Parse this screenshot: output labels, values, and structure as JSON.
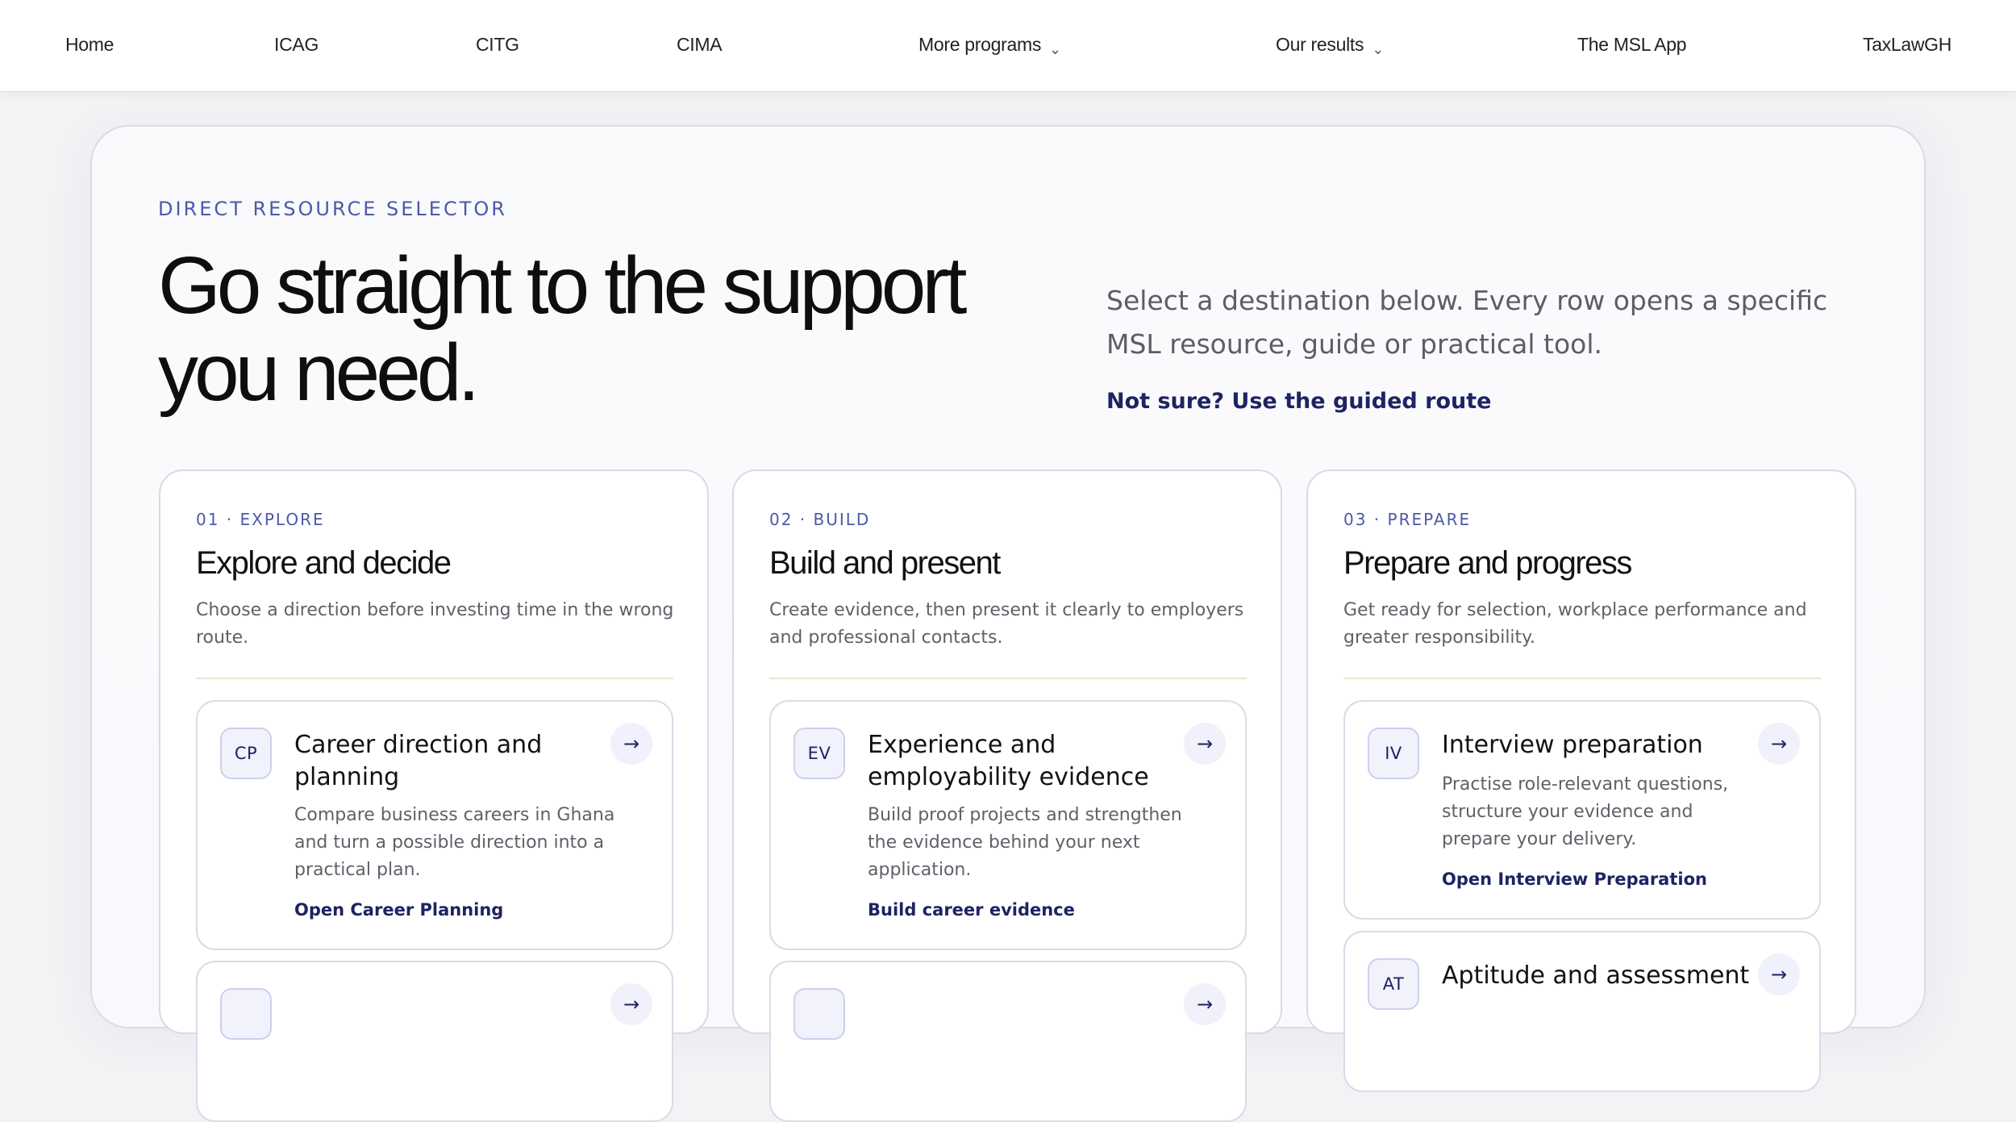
{
  "nav": {
    "items": [
      {
        "label": "Home"
      },
      {
        "label": "ICAG"
      },
      {
        "label": "CITG"
      },
      {
        "label": "CIMA"
      },
      {
        "label": "More programs",
        "dropdown": true
      },
      {
        "label": "Our results",
        "dropdown": true
      },
      {
        "label": "The MSL App"
      },
      {
        "label": "TaxLawGH"
      }
    ],
    "chevron_icon": "chevron-down-icon"
  },
  "hero": {
    "eyebrow": "DIRECT RESOURCE SELECTOR",
    "title": "Go straight to the support you need.",
    "description": "Select a destination below. Every row opens a specific MSL resource, guide or practical tool.",
    "link": "Not sure? Use the guided route"
  },
  "columns": [
    {
      "step": "01 · EXPLORE",
      "title": "Explore and decide",
      "description": "Choose a direction before investing time in the wrong route.",
      "cards": [
        {
          "badge": "CP",
          "title": "Career direction and planning",
          "description": "Compare business careers in Ghana and turn a possible direction into a practical plan.",
          "link": "Open Career Planning"
        }
      ]
    },
    {
      "step": "02 · BUILD",
      "title": "Build and present",
      "description": "Create evidence, then present it clearly to employers and professional contacts.",
      "cards": [
        {
          "badge": "EV",
          "title": "Experience and employability evidence",
          "description": "Build proof projects and strengthen the evidence behind your next application.",
          "link": "Build career evidence"
        }
      ]
    },
    {
      "step": "03 · PREPARE",
      "title": "Prepare and progress",
      "description": "Get ready for selection, workplace performance and greater responsibility.",
      "cards": [
        {
          "badge": "IV",
          "title": "Interview preparation",
          "description": "Practise role-relevant questions, structure your evidence and prepare your delivery.",
          "link": "Open Interview Preparation"
        },
        {
          "badge": "AT",
          "title": "Aptitude and assessment"
        }
      ]
    }
  ],
  "icons": {
    "arrow": "arrow-right-icon"
  },
  "colors": {
    "accent": "#4b59a8",
    "link": "#1e2363",
    "badge_bg": "#f1f2fb"
  }
}
